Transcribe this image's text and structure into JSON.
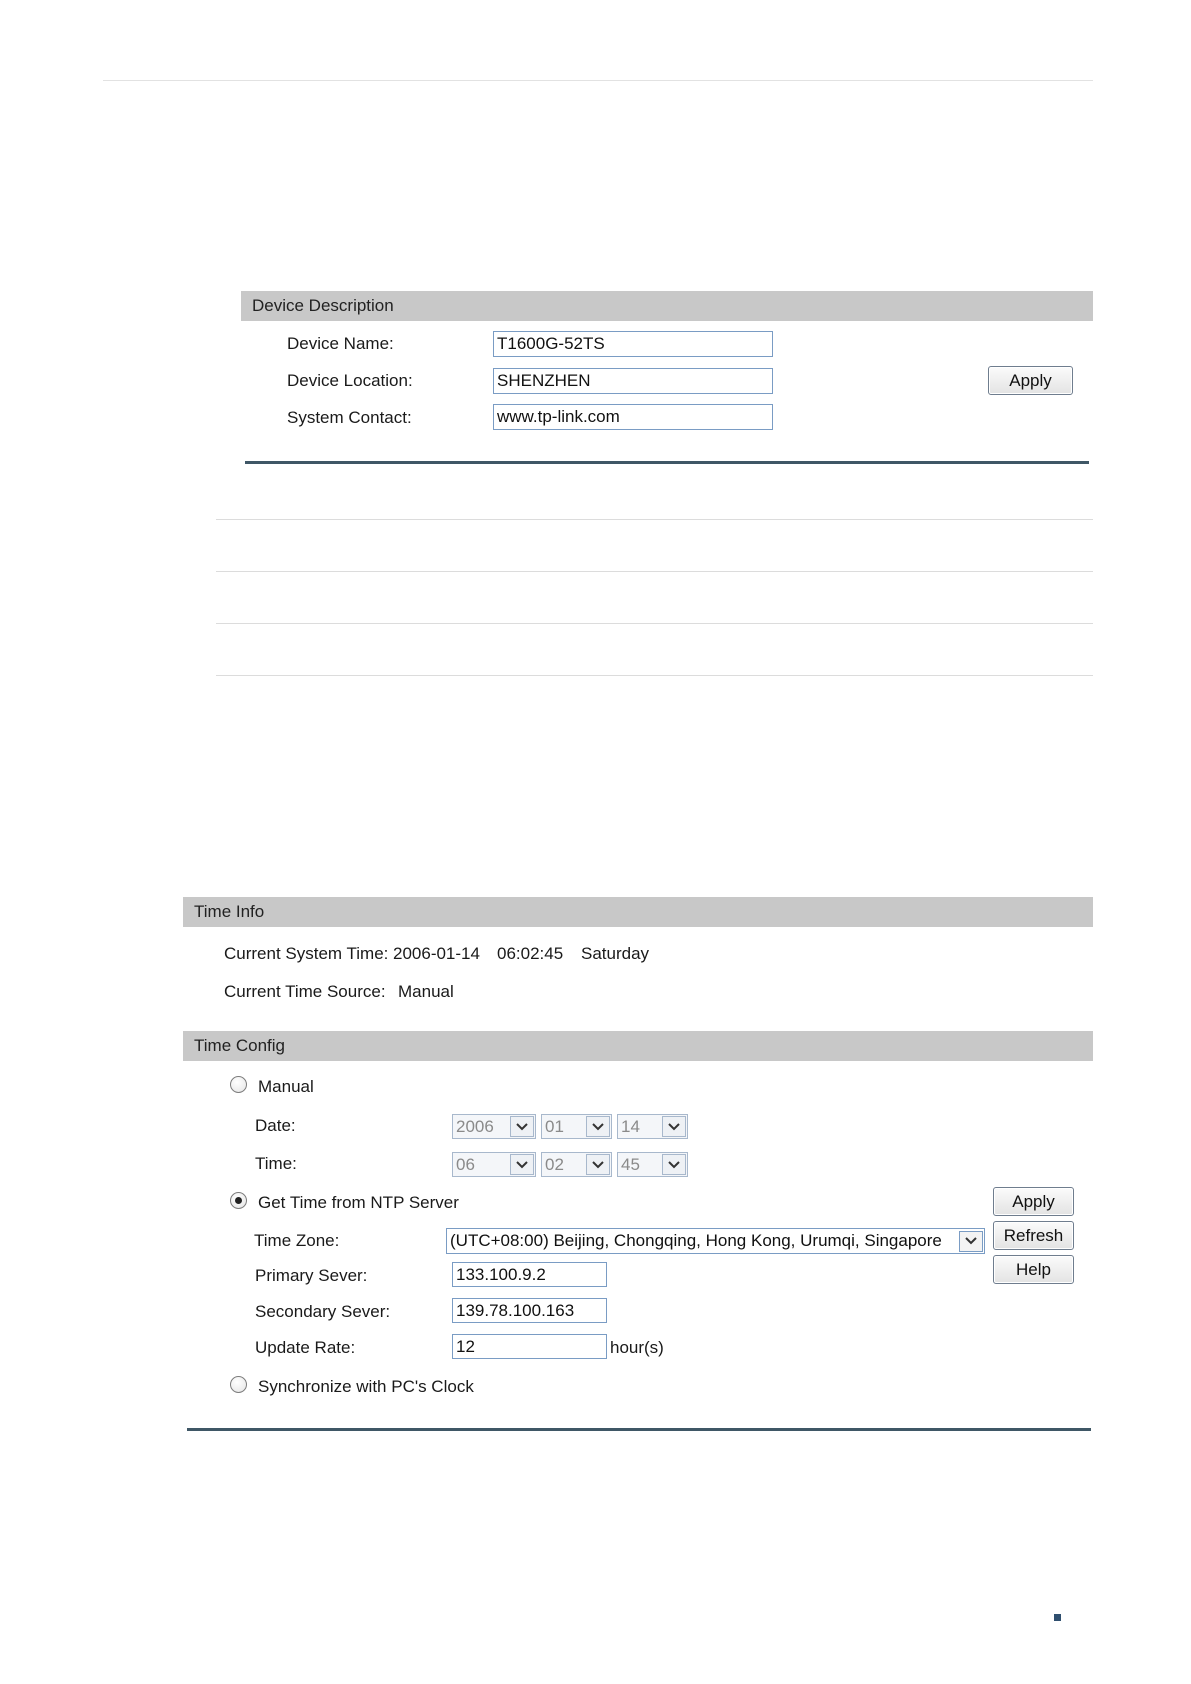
{
  "device_description": {
    "header": "Device Description",
    "device_name_label": "Device Name:",
    "device_name_value": "T1600G-52TS",
    "device_location_label": "Device Location:",
    "device_location_value": "SHENZHEN",
    "system_contact_label": "System Contact:",
    "system_contact_value": "www.tp-link.com",
    "apply_label": "Apply"
  },
  "time_info": {
    "header": "Time Info",
    "current_system_time_label": "Current System Time:",
    "current_date": "2006-01-14",
    "current_time": "06:02:45",
    "current_day": "Saturday",
    "current_time_source_label": "Current Time Source:",
    "current_time_source_value": "Manual"
  },
  "time_config": {
    "header": "Time Config",
    "manual_label": "Manual",
    "manual_selected": false,
    "date_label": "Date:",
    "date_year": "2006",
    "date_month": "01",
    "date_day": "14",
    "time_label": "Time:",
    "time_hour": "06",
    "time_minute": "02",
    "time_second": "45",
    "ntp_label": "Get Time from NTP Server",
    "ntp_selected": true,
    "time_zone_label": "Time Zone:",
    "time_zone_value": "(UTC+08:00) Beijing, Chongqing, Hong Kong, Urumqi, Singapore",
    "primary_server_label": "Primary Sever:",
    "primary_server_value": "133.100.9.2",
    "secondary_server_label": "Secondary Sever:",
    "secondary_server_value": "139.78.100.163",
    "update_rate_label": "Update Rate:",
    "update_rate_value": "12",
    "update_rate_unit": "hour(s)",
    "sync_pc_label": "Synchronize with PC's Clock",
    "sync_pc_selected": false,
    "apply_label": "Apply",
    "refresh_label": "Refresh",
    "help_label": "Help"
  }
}
